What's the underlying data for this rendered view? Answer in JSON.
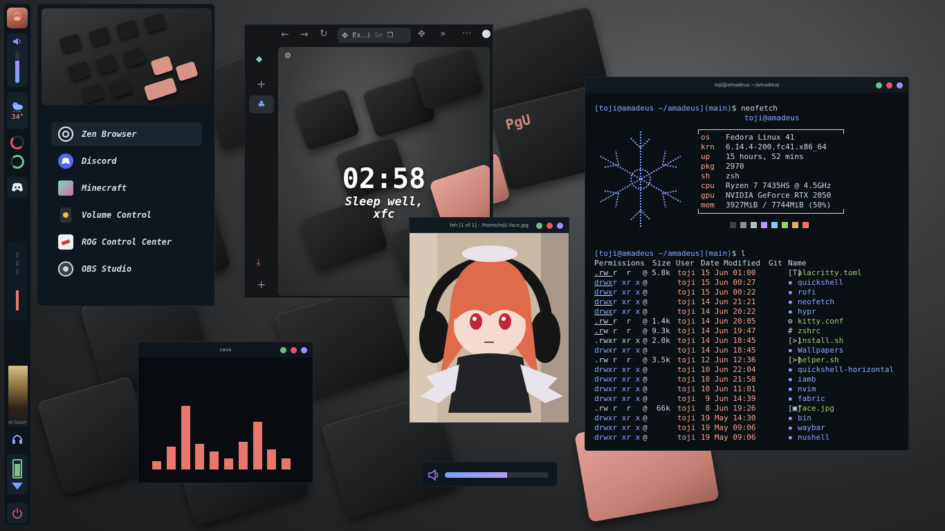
{
  "colors": {
    "accent_pink": "#e8776d",
    "accent_purple": "#a58bff",
    "accent_green": "#78c28a",
    "terminal_blue": "#8aa7ff",
    "terminal_orange": "#f2a48a",
    "dot_green": "#6fbf87",
    "dot_red": "#e8576a",
    "dot_purple": "#a58bff"
  },
  "bar": {
    "weather_temp": "34°",
    "volume_level": 0.7,
    "brightness_level": 0.35,
    "battery_level": 0.85,
    "media_caption": "ol Soun"
  },
  "launcher": {
    "apps": [
      {
        "label": "Zen Browser",
        "icon": "zen-browser-icon"
      },
      {
        "label": "Discord",
        "icon": "discord-icon"
      },
      {
        "label": "Minecraft",
        "icon": "minecraft-icon"
      },
      {
        "label": "Volume Control",
        "icon": "volume-control-icon"
      },
      {
        "label": "ROG Control Center",
        "icon": "rog-icon"
      },
      {
        "label": "OBS Studio",
        "icon": "obs-icon"
      }
    ]
  },
  "browser": {
    "tab_label": "Ex...)",
    "search_hint": "Se",
    "clock_time": "02:58",
    "greeting_line1": "Sleep well,",
    "greeting_line2": "xfc"
  },
  "terminal": {
    "title": "toji@amadeus:~/amadeus",
    "prompt_user": "[toji@amadeus ~/amadeus]",
    "prompt_branch": "(main)",
    "prompt_symbol": "$",
    "cmd1": "neofetch",
    "cmd2": "l",
    "neofetch_header": "toji@amadeus",
    "neofetch": [
      {
        "key": "os",
        "value": "Fedora Linux 41"
      },
      {
        "key": "krn",
        "value": "6.14.4-200.fc41.x86_64"
      },
      {
        "key": "up",
        "value": "15 hours, 52 mins"
      },
      {
        "key": "pkg",
        "value": "2970"
      },
      {
        "key": "sh",
        "value": "zsh"
      },
      {
        "key": "cpu",
        "value": "Ryzen 7 7435HS @ 4.5GHz"
      },
      {
        "key": "gpu",
        "value": "NVIDIA GeForce RTX 2050"
      },
      {
        "key": "mem",
        "value": "3927MiB / 7744MiB (50%)"
      }
    ],
    "palette": [
      "#3a3f46",
      "#8a9098",
      "#b7bcc2",
      "#bb9af7",
      "#7dcfff",
      "#9ece6a",
      "#e0af68",
      "#e8776d"
    ],
    "ls_headers": [
      "Permissions",
      "Size",
      "User",
      "Date Modified",
      "Git",
      "Name"
    ],
    "ls_rows": [
      {
        "perm": ".rw r  r ",
        "size": "@ 5.8k",
        "user": "toji",
        "date": "15 Jun 01:00",
        "icon": "[T]",
        "name": "alacritty.toml",
        "dir": false
      },
      {
        "perm": "drwxr xr x",
        "size": "@",
        "user": "toji",
        "date": "15 Jun 00:27",
        "icon": "▪",
        "name": "quickshell",
        "dir": true
      },
      {
        "perm": "drwxr xr x",
        "size": "@",
        "user": "toji",
        "date": "15 Jun 00:22",
        "icon": "▪",
        "name": "rofi",
        "dir": true
      },
      {
        "perm": "drwxr xr x",
        "size": "@",
        "user": "toji",
        "date": "14 Jun 21:21",
        "icon": "▪",
        "name": "neofetch",
        "dir": true
      },
      {
        "perm": "drwxr xr x",
        "size": "@",
        "user": "toji",
        "date": "14 Jun 20:22",
        "icon": "▪",
        "name": "hypr",
        "dir": true
      },
      {
        "perm": ".rw r  r ",
        "size": "@ 1.4k",
        "user": "toji",
        "date": "14 Jun 20:05",
        "icon": "⚙",
        "name": "kitty.conf",
        "dir": false
      },
      {
        "perm": ".rw r  r ",
        "size": "@ 9.3k",
        "user": "toji",
        "date": "14 Jun 19:47",
        "icon": "#",
        "name": "zshrc",
        "dir": false
      },
      {
        "perm": ".rwxr xr x",
        "size": "@ 2.0k",
        "user": "toji",
        "date": "14 Jun 18:45",
        "icon": "[>]",
        "name": "install.sh",
        "dir": false
      },
      {
        "perm": "drwxr xr x",
        "size": "@",
        "user": "toji",
        "date": "14 Jun 18:45",
        "icon": "▪",
        "name": "Wallpapers",
        "dir": true
      },
      {
        "perm": ".rw r  r ",
        "size": "@ 3.5k",
        "user": "toji",
        "date": "12 Jun 12:36",
        "icon": "[>]",
        "name": "helper.sh",
        "dir": false
      },
      {
        "perm": "drwxr xr x",
        "size": "@",
        "user": "toji",
        "date": "10 Jun 22:04",
        "icon": "▪",
        "name": "quickshell-horizontal",
        "dir": true
      },
      {
        "perm": "drwxr xr x",
        "size": "@",
        "user": "toji",
        "date": "10 Jun 21:58",
        "icon": "▪",
        "name": "iamb",
        "dir": true
      },
      {
        "perm": "drwxr xr x",
        "size": "@",
        "user": "toji",
        "date": "10 Jun 11:01",
        "icon": "▪",
        "name": "nvim",
        "dir": true
      },
      {
        "perm": "drwxr xr x",
        "size": "@",
        "user": "toji",
        "date": " 9 Jun 14:39",
        "icon": "▪",
        "name": "fabric",
        "dir": true
      },
      {
        "perm": ".rw r  r ",
        "size": "@  66k",
        "user": "toji",
        "date": " 8 Jun 19:26",
        "icon": "[▣]",
        "name": "face.jpg",
        "dir": false
      },
      {
        "perm": "drwxr xr x",
        "size": "@",
        "user": "toji",
        "date": "19 May 14:30",
        "icon": "▪",
        "name": "bin",
        "dir": true
      },
      {
        "perm": "drwxr xr x",
        "size": "@",
        "user": "toji",
        "date": "19 May 09:06",
        "icon": "▪",
        "name": "waybar",
        "dir": true
      },
      {
        "perm": "drwxr xr x",
        "size": "@",
        "user": "toji",
        "date": "19 May 09:06",
        "icon": "▪",
        "name": "nushell",
        "dir": true
      }
    ]
  },
  "feh": {
    "title": "feh [1 of 1] - /home/toji/.face.jpg"
  },
  "cava": {
    "title": "cava",
    "levels": [
      0.1,
      0.27,
      0.74,
      0.3,
      0.21,
      0.13,
      0.32,
      0.56,
      0.23,
      0.13
    ]
  },
  "osd": {
    "volume_level": 0.6
  }
}
